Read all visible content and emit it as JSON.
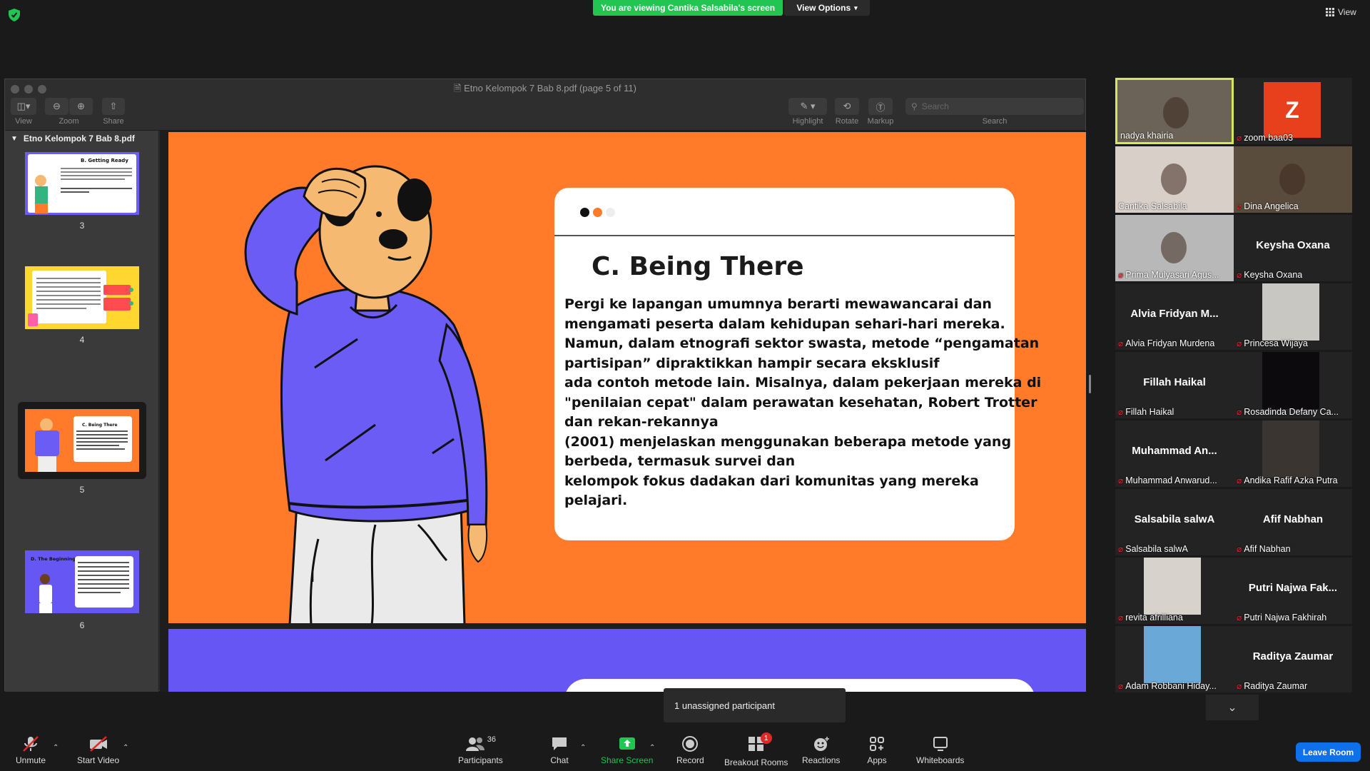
{
  "top": {
    "banner": "You are viewing Cantika Salsabila's screen",
    "view_options": "View Options",
    "view_label": "View"
  },
  "shared_window": {
    "title": "Etno Kelompok 7 Bab 8.pdf (page 5 of 11)",
    "toolbar": {
      "view": "View",
      "zoom": "Zoom",
      "share": "Share",
      "highlight": "Highlight",
      "rotate": "Rotate",
      "markup": "Markup",
      "search": "Search",
      "search_placeholder": "Search"
    },
    "sidebar": {
      "title": "Etno Kelompok 7 Bab 8.pdf",
      "pages": [
        {
          "num": "3",
          "heading": "B. Getting Ready"
        },
        {
          "num": "4",
          "heading": ""
        },
        {
          "num": "5",
          "heading": "C. Being There",
          "selected": true
        },
        {
          "num": "6",
          "heading": "D. The Beginning"
        }
      ]
    },
    "slide": {
      "heading": "C. Being There",
      "body_lines": [
        "Pergi ke lapangan umumnya berarti mewawancarai dan",
        "mengamati peserta dalam kehidupan sehari-hari mereka.",
        "Namun, dalam etnografi sektor swasta, metode “pengamatan",
        "partisipan” dipraktikkan hampir secara eksklusif",
        "ada contoh metode lain. Misalnya, dalam pekerjaan mereka di",
        "\"penilaian cepat\" dalam perawatan kesehatan, Robert Trotter",
        "dan rekan-rekannya",
        "(2001) menjelaskan menggunakan beberapa metode yang",
        "berbeda, termasuk survei dan",
        "kelompok fokus dadakan dari komunitas yang mereka",
        "pelajari."
      ],
      "colors": {
        "background": "#ff7b2a",
        "shirt": "#6a5cf5",
        "next_slide": "#6657f5"
      }
    }
  },
  "gallery": [
    {
      "label": "nadya khairia",
      "type": "video",
      "bg": "#6b6358",
      "active": true,
      "muted": false
    },
    {
      "label": "zoom baa03",
      "type": "avatar",
      "avatar_letter": "Z",
      "avatar_color": "#e8401c",
      "muted": true
    },
    {
      "label": "Cantika Salsabila",
      "type": "video",
      "bg": "#d9cfc9",
      "muted": false
    },
    {
      "label": "Dina Angelica",
      "type": "video",
      "bg": "#5a4c3c",
      "muted": true
    },
    {
      "label": "Prima Mulyasari Agus...",
      "type": "video",
      "bg": "#b8b8b8",
      "muted": true
    },
    {
      "label": "Keysha Oxana",
      "type": "name",
      "big_name": "Keysha Oxana",
      "muted": true
    },
    {
      "label": "Alvia Fridyan Murdena",
      "type": "name",
      "big_name": "Alvia  Fridyan  M...",
      "muted": true
    },
    {
      "label": "Princesa Wijaya",
      "type": "video-small",
      "bg": "#c9c7c2",
      "muted": true
    },
    {
      "label": "Fillah Haikal",
      "type": "name",
      "big_name": "Fillah Haikal",
      "muted": true
    },
    {
      "label": "Rosadinda Defany Ca...",
      "type": "video-small",
      "bg": "#0c0a0d",
      "muted": true
    },
    {
      "label": "Muhammad Anwarud...",
      "type": "name",
      "big_name": "Muhammad  An...",
      "muted": true
    },
    {
      "label": "Andika Rafif Azka Putra",
      "type": "video-small",
      "bg": "#3a3530",
      "muted": true
    },
    {
      "label": "Salsabila salwA",
      "type": "name",
      "big_name": "Salsabila salwA",
      "muted": true
    },
    {
      "label": "Afif Nabhan",
      "type": "name",
      "big_name": "Afif Nabhan",
      "muted": true
    },
    {
      "label": "revita afrilliana",
      "type": "video-small",
      "bg": "#d8d2cc",
      "muted": true
    },
    {
      "label": "Putri Najwa Fakhirah",
      "type": "name",
      "big_name": "Putri  Najwa  Fak...",
      "muted": true
    },
    {
      "label": "Adam Robbani Hiday...",
      "type": "video-small",
      "bg": "#6aa8d8",
      "muted": true
    },
    {
      "label": "Raditya Zaumar",
      "type": "name",
      "big_name": "Raditya Zaumar",
      "muted": true
    }
  ],
  "tooltip": "1 unassigned participant",
  "toolbar": {
    "unmute": "Unmute",
    "start_video": "Start Video",
    "participants": "Participants",
    "participants_count": "36",
    "chat": "Chat",
    "share_screen": "Share Screen",
    "record": "Record",
    "breakout_rooms": "Breakout Rooms",
    "breakout_badge": "1",
    "reactions": "Reactions",
    "apps": "Apps",
    "whiteboards": "Whiteboards",
    "leave_room": "Leave Room",
    "share_color": "#23c552"
  }
}
